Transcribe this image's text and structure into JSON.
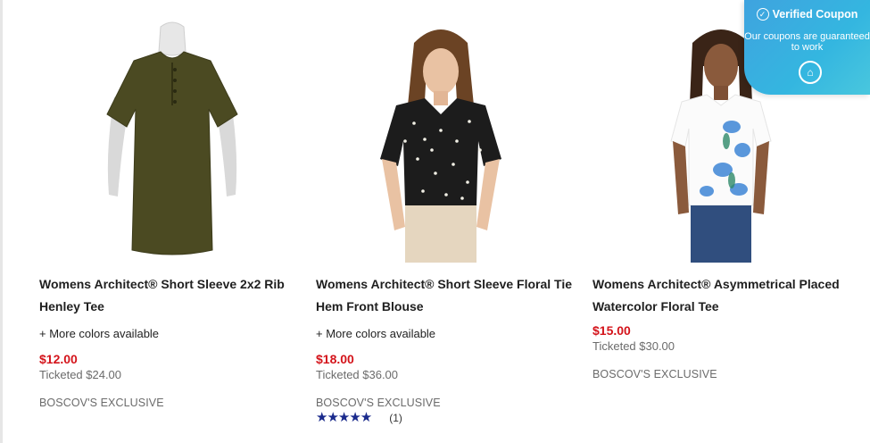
{
  "coupon": {
    "heading": "Verified Coupon",
    "subtext": "Our coupons are guaranteed to work",
    "check_icon": "check-circle-icon",
    "logo_icon": "coupon-logo-icon",
    "colors": {
      "gradient_start": "#3fa3df",
      "gradient_end": "#49c7de"
    }
  },
  "products": [
    {
      "title": "Womens Architect® Short Sleeve 2x2 Rib Henley Tee",
      "more_colors": "+ More colors available",
      "price": "$12.00",
      "ticketed": "Ticketed $24.00",
      "exclusive": "BOSCOV'S EXCLUSIVE",
      "image": "olive-henley-tee-on-mannequin"
    },
    {
      "title": "Womens Architect® Short Sleeve Floral Tie Hem Front Blouse",
      "more_colors": "+ More colors available",
      "price": "$18.00",
      "ticketed": "Ticketed $36.00",
      "exclusive": "BOSCOV'S EXCLUSIVE",
      "rating_stars": 5,
      "rating_count": "(1)",
      "image": "model-in-floral-tie-front-blouse"
    },
    {
      "title": "Womens Architect® Asymmetrical Placed Watercolor Floral Tee",
      "price": "$15.00",
      "ticketed": "Ticketed $30.00",
      "exclusive": "BOSCOV'S EXCLUSIVE",
      "image": "model-in-watercolor-floral-tee"
    }
  ],
  "colors": {
    "sale_price": "#d4141b",
    "star": "#1a2a8c"
  }
}
